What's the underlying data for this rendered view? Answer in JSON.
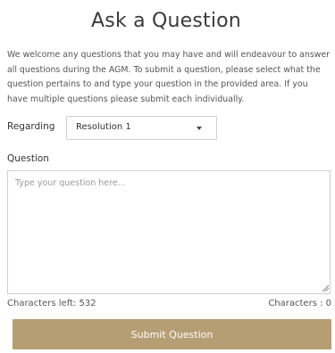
{
  "form": {
    "title": "Ask a Question",
    "intro": "We welcome any questions that you may have and will endeavour to answer all questions during the AGM. To submit a question, please select what the question pertains to and type your question in the provided area. If you have multiple questions please submit each individually.",
    "regarding_label": "Regarding",
    "regarding_selected": "Resolution 1",
    "question_label": "Question",
    "question_value": "",
    "question_placeholder": "Type your question here...",
    "chars_left": "Characters left: 532",
    "chars_count": "Characters : 0",
    "submit_label": "Submit Question"
  },
  "icons": {
    "select_caret": "chevron-down-icon",
    "resize": "resize-grip-icon"
  },
  "colors": {
    "button_bg": "#b59d74",
    "button_text": "#ffffff",
    "border": "#cfcfcf"
  }
}
